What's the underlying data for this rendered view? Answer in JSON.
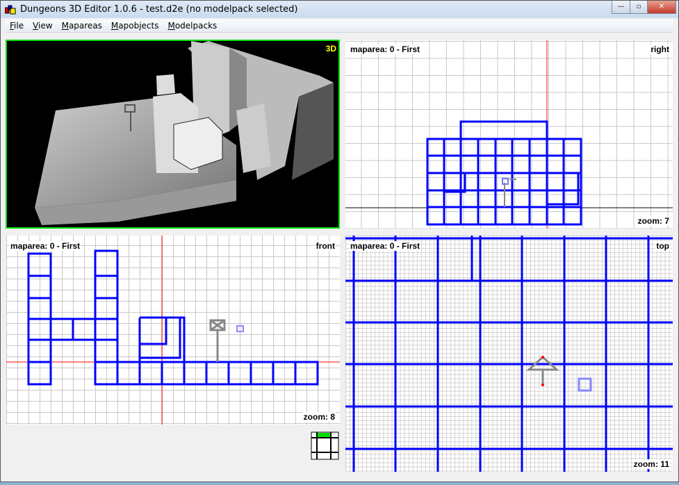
{
  "window": {
    "title": "Dungeons 3D Editor 1.0.6 - test.d2e (no modelpack selected)",
    "minimize": "—",
    "maximize": "▫",
    "close": "✕"
  },
  "menu": [
    {
      "label": "File",
      "key": "F",
      "rest": "ile"
    },
    {
      "label": "View",
      "key": "V",
      "rest": "iew"
    },
    {
      "label": "Mapareas",
      "key": "M",
      "rest": "apareas"
    },
    {
      "label": "Mapobjects",
      "key": "M",
      "rest": "apobjects"
    },
    {
      "label": "Modelpacks",
      "key": "M",
      "rest": "odelpacks"
    }
  ],
  "views": {
    "view3d": {
      "label": "3D"
    },
    "right": {
      "maparea": "maparea: 0 - First",
      "name": "right",
      "zoom": "zoom: 7"
    },
    "front": {
      "maparea": "maparea: 0 - First",
      "name": "front",
      "zoom": "zoom: 8"
    },
    "top": {
      "maparea": "maparea: 0 - First",
      "name": "top",
      "zoom": "zoom: 11"
    }
  },
  "colors": {
    "wall": "#0000ff",
    "active_border": "#00e000",
    "axis": "#ff0000"
  }
}
